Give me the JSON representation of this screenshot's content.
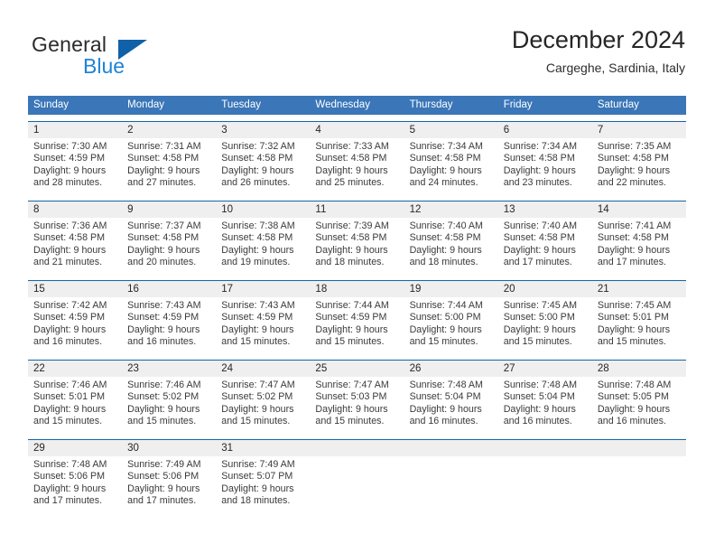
{
  "brand": {
    "general_text": "General",
    "blue_text": "Blue",
    "accent_color": "#1e84d6",
    "triangle_color": "#1061a8"
  },
  "header": {
    "title": "December 2024",
    "subtitle": "Cargeghe, Sardinia, Italy"
  },
  "colors": {
    "weekday_header_bg": "#3a76b8",
    "week_rule": "#1565a8",
    "daynum_band": "#efefef",
    "text": "#3a3a3a"
  },
  "weekdays": [
    "Sunday",
    "Monday",
    "Tuesday",
    "Wednesday",
    "Thursday",
    "Friday",
    "Saturday"
  ],
  "weeks": [
    {
      "days": [
        {
          "num": "1",
          "l1": "Sunrise: 7:30 AM",
          "l2": "Sunset: 4:59 PM",
          "l3": "Daylight: 9 hours",
          "l4": "and 28 minutes."
        },
        {
          "num": "2",
          "l1": "Sunrise: 7:31 AM",
          "l2": "Sunset: 4:58 PM",
          "l3": "Daylight: 9 hours",
          "l4": "and 27 minutes."
        },
        {
          "num": "3",
          "l1": "Sunrise: 7:32 AM",
          "l2": "Sunset: 4:58 PM",
          "l3": "Daylight: 9 hours",
          "l4": "and 26 minutes."
        },
        {
          "num": "4",
          "l1": "Sunrise: 7:33 AM",
          "l2": "Sunset: 4:58 PM",
          "l3": "Daylight: 9 hours",
          "l4": "and 25 minutes."
        },
        {
          "num": "5",
          "l1": "Sunrise: 7:34 AM",
          "l2": "Sunset: 4:58 PM",
          "l3": "Daylight: 9 hours",
          "l4": "and 24 minutes."
        },
        {
          "num": "6",
          "l1": "Sunrise: 7:34 AM",
          "l2": "Sunset: 4:58 PM",
          "l3": "Daylight: 9 hours",
          "l4": "and 23 minutes."
        },
        {
          "num": "7",
          "l1": "Sunrise: 7:35 AM",
          "l2": "Sunset: 4:58 PM",
          "l3": "Daylight: 9 hours",
          "l4": "and 22 minutes."
        }
      ]
    },
    {
      "days": [
        {
          "num": "8",
          "l1": "Sunrise: 7:36 AM",
          "l2": "Sunset: 4:58 PM",
          "l3": "Daylight: 9 hours",
          "l4": "and 21 minutes."
        },
        {
          "num": "9",
          "l1": "Sunrise: 7:37 AM",
          "l2": "Sunset: 4:58 PM",
          "l3": "Daylight: 9 hours",
          "l4": "and 20 minutes."
        },
        {
          "num": "10",
          "l1": "Sunrise: 7:38 AM",
          "l2": "Sunset: 4:58 PM",
          "l3": "Daylight: 9 hours",
          "l4": "and 19 minutes."
        },
        {
          "num": "11",
          "l1": "Sunrise: 7:39 AM",
          "l2": "Sunset: 4:58 PM",
          "l3": "Daylight: 9 hours",
          "l4": "and 18 minutes."
        },
        {
          "num": "12",
          "l1": "Sunrise: 7:40 AM",
          "l2": "Sunset: 4:58 PM",
          "l3": "Daylight: 9 hours",
          "l4": "and 18 minutes."
        },
        {
          "num": "13",
          "l1": "Sunrise: 7:40 AM",
          "l2": "Sunset: 4:58 PM",
          "l3": "Daylight: 9 hours",
          "l4": "and 17 minutes."
        },
        {
          "num": "14",
          "l1": "Sunrise: 7:41 AM",
          "l2": "Sunset: 4:58 PM",
          "l3": "Daylight: 9 hours",
          "l4": "and 17 minutes."
        }
      ]
    },
    {
      "days": [
        {
          "num": "15",
          "l1": "Sunrise: 7:42 AM",
          "l2": "Sunset: 4:59 PM",
          "l3": "Daylight: 9 hours",
          "l4": "and 16 minutes."
        },
        {
          "num": "16",
          "l1": "Sunrise: 7:43 AM",
          "l2": "Sunset: 4:59 PM",
          "l3": "Daylight: 9 hours",
          "l4": "and 16 minutes."
        },
        {
          "num": "17",
          "l1": "Sunrise: 7:43 AM",
          "l2": "Sunset: 4:59 PM",
          "l3": "Daylight: 9 hours",
          "l4": "and 15 minutes."
        },
        {
          "num": "18",
          "l1": "Sunrise: 7:44 AM",
          "l2": "Sunset: 4:59 PM",
          "l3": "Daylight: 9 hours",
          "l4": "and 15 minutes."
        },
        {
          "num": "19",
          "l1": "Sunrise: 7:44 AM",
          "l2": "Sunset: 5:00 PM",
          "l3": "Daylight: 9 hours",
          "l4": "and 15 minutes."
        },
        {
          "num": "20",
          "l1": "Sunrise: 7:45 AM",
          "l2": "Sunset: 5:00 PM",
          "l3": "Daylight: 9 hours",
          "l4": "and 15 minutes."
        },
        {
          "num": "21",
          "l1": "Sunrise: 7:45 AM",
          "l2": "Sunset: 5:01 PM",
          "l3": "Daylight: 9 hours",
          "l4": "and 15 minutes."
        }
      ]
    },
    {
      "days": [
        {
          "num": "22",
          "l1": "Sunrise: 7:46 AM",
          "l2": "Sunset: 5:01 PM",
          "l3": "Daylight: 9 hours",
          "l4": "and 15 minutes."
        },
        {
          "num": "23",
          "l1": "Sunrise: 7:46 AM",
          "l2": "Sunset: 5:02 PM",
          "l3": "Daylight: 9 hours",
          "l4": "and 15 minutes."
        },
        {
          "num": "24",
          "l1": "Sunrise: 7:47 AM",
          "l2": "Sunset: 5:02 PM",
          "l3": "Daylight: 9 hours",
          "l4": "and 15 minutes."
        },
        {
          "num": "25",
          "l1": "Sunrise: 7:47 AM",
          "l2": "Sunset: 5:03 PM",
          "l3": "Daylight: 9 hours",
          "l4": "and 15 minutes."
        },
        {
          "num": "26",
          "l1": "Sunrise: 7:48 AM",
          "l2": "Sunset: 5:04 PM",
          "l3": "Daylight: 9 hours",
          "l4": "and 16 minutes."
        },
        {
          "num": "27",
          "l1": "Sunrise: 7:48 AM",
          "l2": "Sunset: 5:04 PM",
          "l3": "Daylight: 9 hours",
          "l4": "and 16 minutes."
        },
        {
          "num": "28",
          "l1": "Sunrise: 7:48 AM",
          "l2": "Sunset: 5:05 PM",
          "l3": "Daylight: 9 hours",
          "l4": "and 16 minutes."
        }
      ]
    },
    {
      "days": [
        {
          "num": "29",
          "l1": "Sunrise: 7:48 AM",
          "l2": "Sunset: 5:06 PM",
          "l3": "Daylight: 9 hours",
          "l4": "and 17 minutes."
        },
        {
          "num": "30",
          "l1": "Sunrise: 7:49 AM",
          "l2": "Sunset: 5:06 PM",
          "l3": "Daylight: 9 hours",
          "l4": "and 17 minutes."
        },
        {
          "num": "31",
          "l1": "Sunrise: 7:49 AM",
          "l2": "Sunset: 5:07 PM",
          "l3": "Daylight: 9 hours",
          "l4": "and 18 minutes."
        },
        {
          "num": "",
          "l1": "",
          "l2": "",
          "l3": "",
          "l4": ""
        },
        {
          "num": "",
          "l1": "",
          "l2": "",
          "l3": "",
          "l4": ""
        },
        {
          "num": "",
          "l1": "",
          "l2": "",
          "l3": "",
          "l4": ""
        },
        {
          "num": "",
          "l1": "",
          "l2": "",
          "l3": "",
          "l4": ""
        }
      ]
    }
  ]
}
